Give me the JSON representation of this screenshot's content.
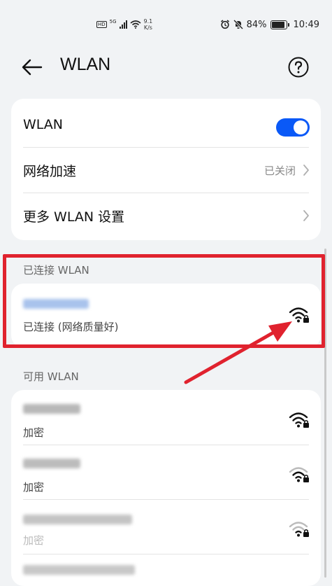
{
  "status_bar": {
    "hd": "HD",
    "network_type": "5G",
    "speed_value": "9.1",
    "speed_unit": "K/s",
    "battery": "84%",
    "battery_level": 0.84,
    "time": "10:49"
  },
  "header": {
    "title": "WLAN"
  },
  "settings": {
    "wlan_label": "WLAN",
    "wlan_enabled": true,
    "accel_label": "网络加速",
    "accel_value": "已关闭",
    "more_label": "更多 WLAN 设置"
  },
  "connected": {
    "section_label": "已连接 WLAN",
    "status": "已连接 (网络质量好)"
  },
  "available": {
    "section_label": "可用 WLAN",
    "networks": [
      {
        "security": "加密"
      },
      {
        "security": "加密"
      },
      {
        "security": "加密"
      }
    ]
  },
  "colors": {
    "accent": "#0a59f7",
    "highlight": "#e0222e",
    "background": "#f1f3f5"
  }
}
